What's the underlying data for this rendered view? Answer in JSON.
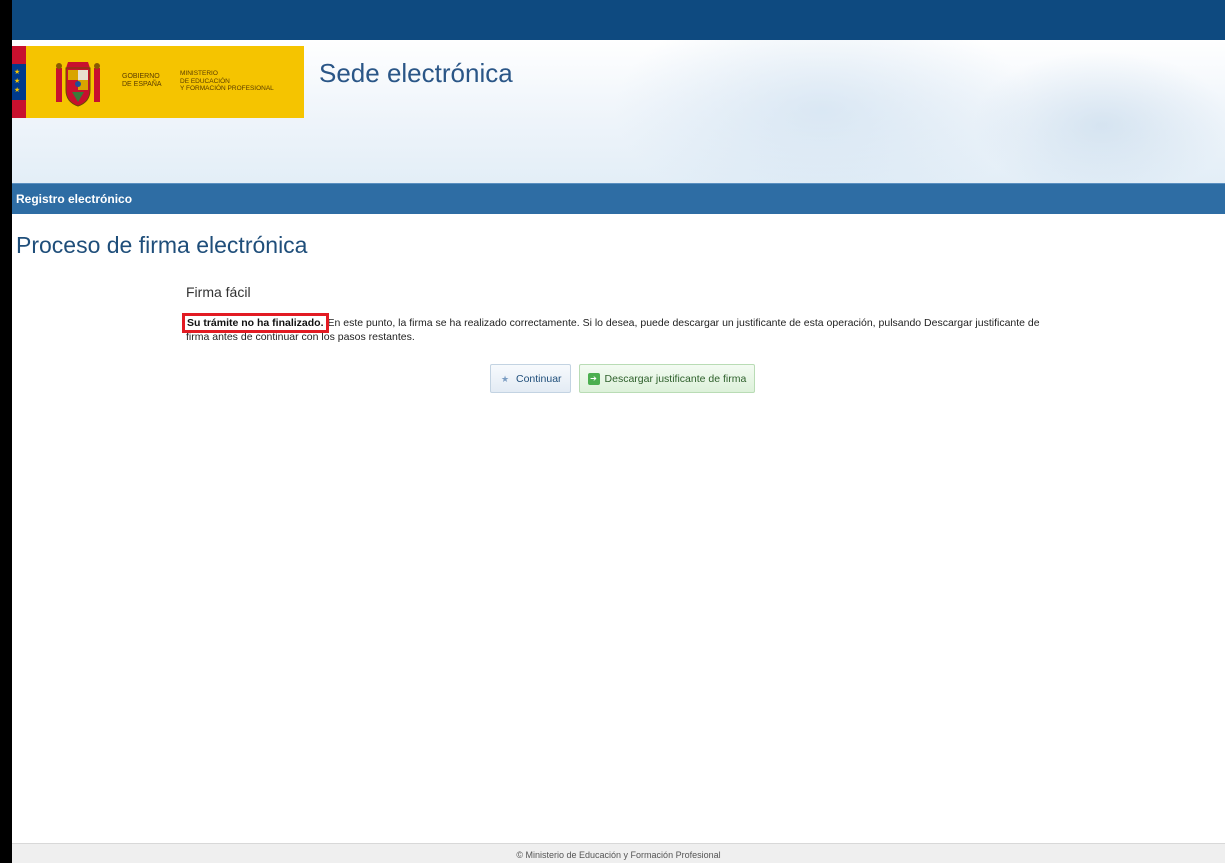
{
  "header": {
    "gov_text": [
      "GOBIERNO",
      "DE ESPAÑA"
    ],
    "ministry_text": [
      "MINISTERIO",
      "DE EDUCACIÓN",
      "Y FORMACIÓN PROFESIONAL"
    ],
    "site_title": "Sede electrónica"
  },
  "nav": {
    "label": "Registro electrónico"
  },
  "main": {
    "page_title": "Proceso de firma electrónica",
    "section_title": "Firma fácil",
    "message_strong": "Su trámite no ha finalizado.",
    "message_rest": "En este punto, la firma se ha realizado correctamente. Si lo desea, puede descargar un justificante de esta operación, pulsando Descargar justificante de firma antes de continuar con los pasos restantes.",
    "buttons": {
      "continue_label": "Continuar",
      "download_label": "Descargar justificante de firma"
    }
  },
  "footer": {
    "text": "© Ministerio de Educación y Formación Profesional"
  },
  "colors": {
    "topbar": "#0e4a80",
    "nav_bar": "#2e6da4",
    "logo_background": "#f5c400",
    "highlight_border": "#e21b23"
  },
  "icons": {
    "continue": "arrow-icon",
    "download": "download-icon"
  }
}
